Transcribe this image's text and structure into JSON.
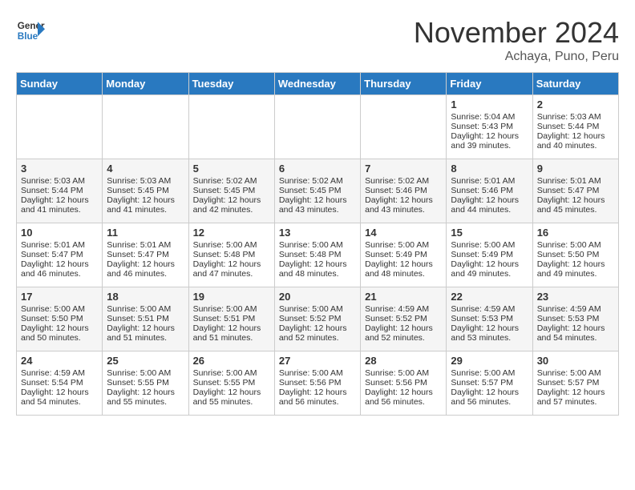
{
  "header": {
    "logo_line1": "General",
    "logo_line2": "Blue",
    "month": "November 2024",
    "location": "Achaya, Puno, Peru"
  },
  "days_of_week": [
    "Sunday",
    "Monday",
    "Tuesday",
    "Wednesday",
    "Thursday",
    "Friday",
    "Saturday"
  ],
  "weeks": [
    [
      {
        "day": "",
        "empty": true
      },
      {
        "day": "",
        "empty": true
      },
      {
        "day": "",
        "empty": true
      },
      {
        "day": "",
        "empty": true
      },
      {
        "day": "",
        "empty": true
      },
      {
        "day": "1",
        "sunrise": "5:04 AM",
        "sunset": "5:43 PM",
        "daylight": "12 hours and 39 minutes."
      },
      {
        "day": "2",
        "sunrise": "5:03 AM",
        "sunset": "5:44 PM",
        "daylight": "12 hours and 40 minutes."
      }
    ],
    [
      {
        "day": "3",
        "sunrise": "5:03 AM",
        "sunset": "5:44 PM",
        "daylight": "12 hours and 41 minutes."
      },
      {
        "day": "4",
        "sunrise": "5:03 AM",
        "sunset": "5:45 PM",
        "daylight": "12 hours and 41 minutes."
      },
      {
        "day": "5",
        "sunrise": "5:02 AM",
        "sunset": "5:45 PM",
        "daylight": "12 hours and 42 minutes."
      },
      {
        "day": "6",
        "sunrise": "5:02 AM",
        "sunset": "5:45 PM",
        "daylight": "12 hours and 43 minutes."
      },
      {
        "day": "7",
        "sunrise": "5:02 AM",
        "sunset": "5:46 PM",
        "daylight": "12 hours and 43 minutes."
      },
      {
        "day": "8",
        "sunrise": "5:01 AM",
        "sunset": "5:46 PM",
        "daylight": "12 hours and 44 minutes."
      },
      {
        "day": "9",
        "sunrise": "5:01 AM",
        "sunset": "5:47 PM",
        "daylight": "12 hours and 45 minutes."
      }
    ],
    [
      {
        "day": "10",
        "sunrise": "5:01 AM",
        "sunset": "5:47 PM",
        "daylight": "12 hours and 46 minutes."
      },
      {
        "day": "11",
        "sunrise": "5:01 AM",
        "sunset": "5:47 PM",
        "daylight": "12 hours and 46 minutes."
      },
      {
        "day": "12",
        "sunrise": "5:00 AM",
        "sunset": "5:48 PM",
        "daylight": "12 hours and 47 minutes."
      },
      {
        "day": "13",
        "sunrise": "5:00 AM",
        "sunset": "5:48 PM",
        "daylight": "12 hours and 48 minutes."
      },
      {
        "day": "14",
        "sunrise": "5:00 AM",
        "sunset": "5:49 PM",
        "daylight": "12 hours and 48 minutes."
      },
      {
        "day": "15",
        "sunrise": "5:00 AM",
        "sunset": "5:49 PM",
        "daylight": "12 hours and 49 minutes."
      },
      {
        "day": "16",
        "sunrise": "5:00 AM",
        "sunset": "5:50 PM",
        "daylight": "12 hours and 49 minutes."
      }
    ],
    [
      {
        "day": "17",
        "sunrise": "5:00 AM",
        "sunset": "5:50 PM",
        "daylight": "12 hours and 50 minutes."
      },
      {
        "day": "18",
        "sunrise": "5:00 AM",
        "sunset": "5:51 PM",
        "daylight": "12 hours and 51 minutes."
      },
      {
        "day": "19",
        "sunrise": "5:00 AM",
        "sunset": "5:51 PM",
        "daylight": "12 hours and 51 minutes."
      },
      {
        "day": "20",
        "sunrise": "5:00 AM",
        "sunset": "5:52 PM",
        "daylight": "12 hours and 52 minutes."
      },
      {
        "day": "21",
        "sunrise": "4:59 AM",
        "sunset": "5:52 PM",
        "daylight": "12 hours and 52 minutes."
      },
      {
        "day": "22",
        "sunrise": "4:59 AM",
        "sunset": "5:53 PM",
        "daylight": "12 hours and 53 minutes."
      },
      {
        "day": "23",
        "sunrise": "4:59 AM",
        "sunset": "5:53 PM",
        "daylight": "12 hours and 54 minutes."
      }
    ],
    [
      {
        "day": "24",
        "sunrise": "4:59 AM",
        "sunset": "5:54 PM",
        "daylight": "12 hours and 54 minutes."
      },
      {
        "day": "25",
        "sunrise": "5:00 AM",
        "sunset": "5:55 PM",
        "daylight": "12 hours and 55 minutes."
      },
      {
        "day": "26",
        "sunrise": "5:00 AM",
        "sunset": "5:55 PM",
        "daylight": "12 hours and 55 minutes."
      },
      {
        "day": "27",
        "sunrise": "5:00 AM",
        "sunset": "5:56 PM",
        "daylight": "12 hours and 56 minutes."
      },
      {
        "day": "28",
        "sunrise": "5:00 AM",
        "sunset": "5:56 PM",
        "daylight": "12 hours and 56 minutes."
      },
      {
        "day": "29",
        "sunrise": "5:00 AM",
        "sunset": "5:57 PM",
        "daylight": "12 hours and 56 minutes."
      },
      {
        "day": "30",
        "sunrise": "5:00 AM",
        "sunset": "5:57 PM",
        "daylight": "12 hours and 57 minutes."
      }
    ]
  ]
}
